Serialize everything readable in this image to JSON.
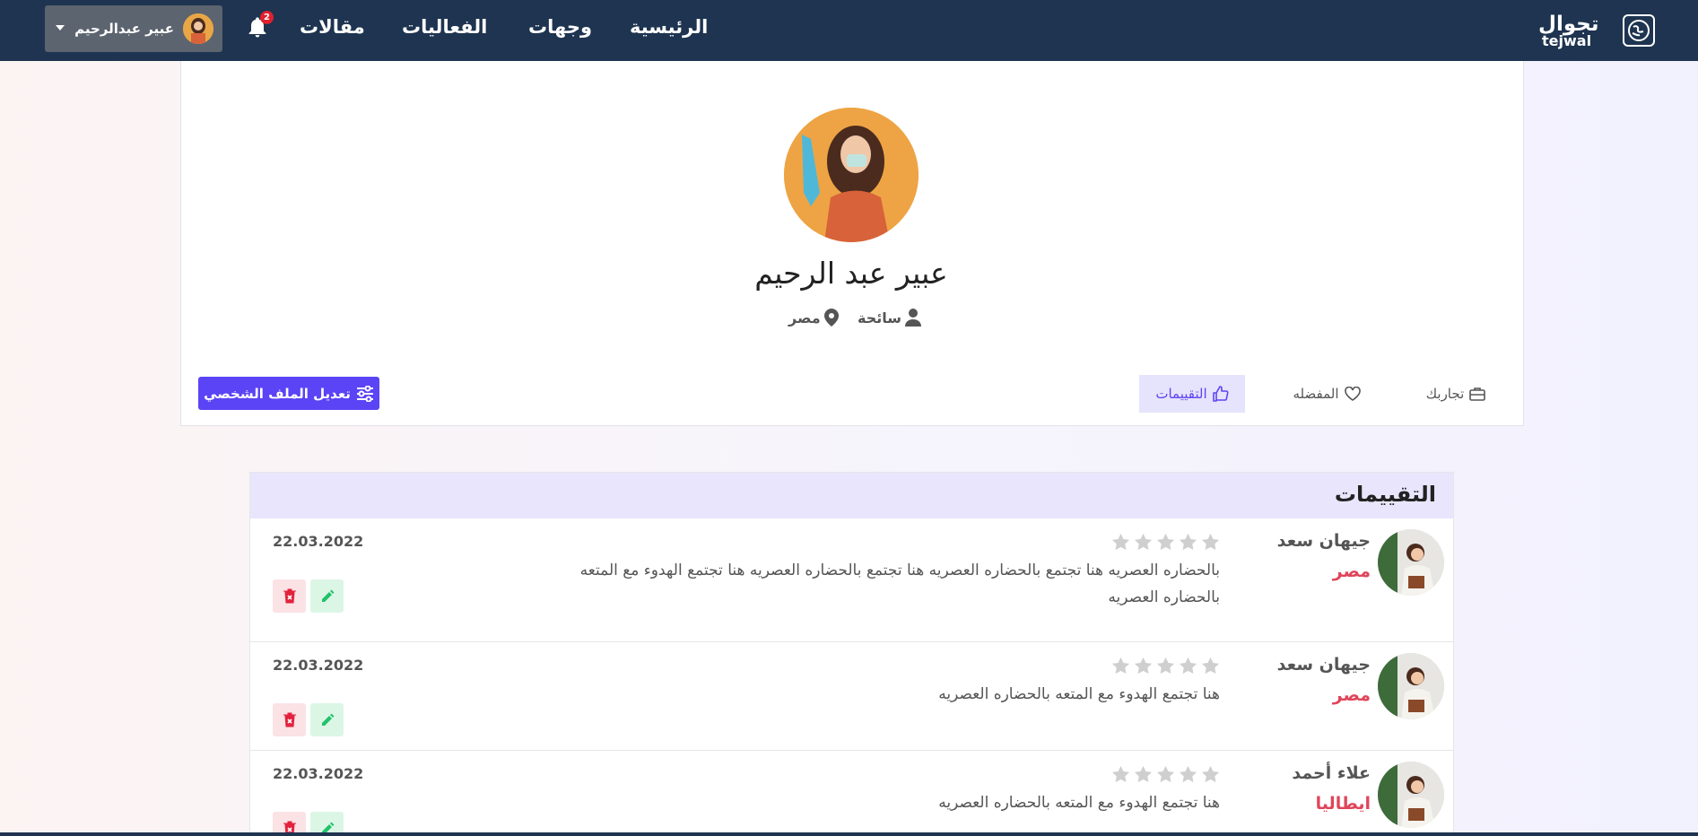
{
  "nav": {
    "logo_text": "تجوال",
    "logo_sub": "tejwal",
    "links": [
      "الرئيسية",
      "وجهات",
      "الفعاليات",
      "مقالات"
    ],
    "notification_count": "2",
    "user_name": "عبير عبدالرحيم"
  },
  "profile": {
    "name": "عبير عبد الرحيم",
    "role": "سائحة",
    "country": "مصر",
    "edit_label": "تعديل الملف الشخصي",
    "tabs": [
      {
        "label": "تجاربك",
        "active": false
      },
      {
        "label": "المفضله",
        "active": false
      },
      {
        "label": "التقييمات",
        "active": true
      }
    ]
  },
  "reviews": {
    "title": "التقييمات",
    "items": [
      {
        "name": "جيهان سعد",
        "country": "مصر",
        "rating": 0,
        "text": "بالحضاره العصريه هنا تجتمع بالحضاره العصريه هنا تجتمع بالحضاره العصريه هنا تجتمع الهدوء مع المتعه بالحضاره العصريه",
        "date": "22.03.2022"
      },
      {
        "name": "جيهان سعد",
        "country": "مصر",
        "rating": 0,
        "text": "هنا تجتمع الهدوء مع المتعه بالحضاره العصريه",
        "date": "22.03.2022"
      },
      {
        "name": "علاء أحمد",
        "country": "ايطاليا",
        "rating": 0,
        "text": "هنا تجتمع الهدوء مع المتعه بالحضاره العصريه",
        "date": "22.03.2022"
      }
    ]
  },
  "colors": {
    "navbar": "#1e3450",
    "accent": "#5b44f5",
    "country": "#e0455a",
    "star_empty": "#cfcfcf"
  }
}
